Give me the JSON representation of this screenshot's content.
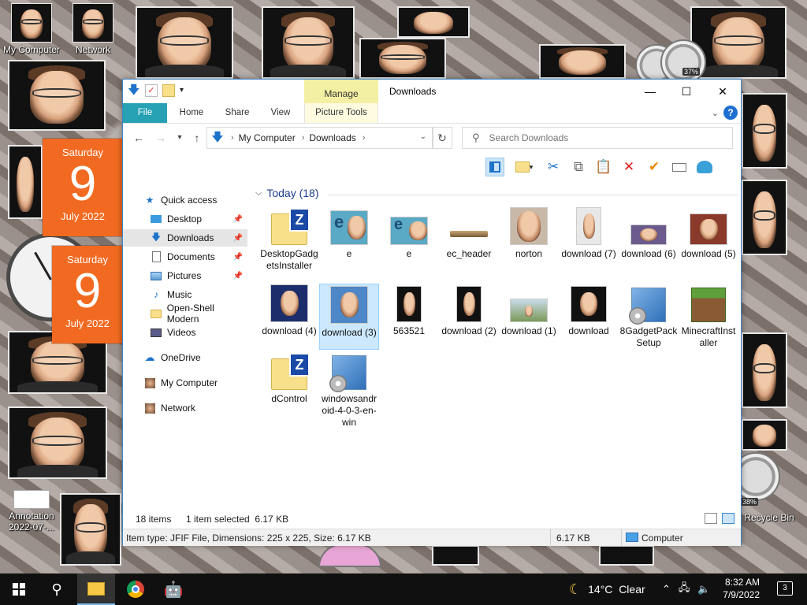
{
  "desktop": {
    "icons": [
      {
        "label": "My Computer"
      },
      {
        "label": "Network"
      },
      {
        "label": "Annotation 2022-07-..."
      },
      {
        "label": "Recycle Bin"
      }
    ],
    "calendars": [
      {
        "weekday": "Saturday",
        "day": "9",
        "month_year": "July 2022"
      },
      {
        "weekday": "Saturday",
        "day": "9",
        "month_year": "July 2022"
      }
    ],
    "gauges": [
      {
        "label": "37%"
      },
      {
        "label": "38%"
      }
    ]
  },
  "window": {
    "title": "Downloads",
    "contextual_tab_group": "Manage",
    "tabs": [
      "File",
      "Home",
      "Share",
      "View",
      "Picture Tools"
    ],
    "controls": {
      "minimize": "—",
      "maximize": "☐",
      "close": "✕"
    },
    "help": "?"
  },
  "address": {
    "breadcrumb": [
      "My Computer",
      "Downloads"
    ],
    "search_placeholder": "Search Downloads"
  },
  "nav_pane": {
    "items": [
      {
        "label": "Quick access",
        "icon": "star-icon"
      },
      {
        "label": "Desktop",
        "icon": "desktop-icon",
        "pinned": true
      },
      {
        "label": "Downloads",
        "icon": "download-icon",
        "pinned": true,
        "selected": true
      },
      {
        "label": "Documents",
        "icon": "documents-icon",
        "pinned": true
      },
      {
        "label": "Pictures",
        "icon": "pictures-icon",
        "pinned": true
      },
      {
        "label": "Music",
        "icon": "music-icon"
      },
      {
        "label": "Open-Shell Modern",
        "icon": "folder-icon"
      },
      {
        "label": "Videos",
        "icon": "videos-icon"
      },
      {
        "label": "OneDrive",
        "icon": "cloud-icon"
      },
      {
        "label": "My Computer",
        "icon": "computer-icon"
      },
      {
        "label": "Network",
        "icon": "network-icon"
      }
    ]
  },
  "files": {
    "group_title": "Today (18)",
    "items": [
      {
        "label": "DesktopGadgetsInstaller",
        "kind": "zip-folder"
      },
      {
        "label": "e",
        "kind": "picture"
      },
      {
        "label": "e",
        "kind": "picture"
      },
      {
        "label": "ec_header",
        "kind": "header"
      },
      {
        "label": "norton",
        "kind": "picture"
      },
      {
        "label": "download (7)",
        "kind": "picture"
      },
      {
        "label": "download (6)",
        "kind": "picture"
      },
      {
        "label": "download (5)",
        "kind": "picture"
      },
      {
        "label": "download (4)",
        "kind": "picture"
      },
      {
        "label": "download (3)",
        "kind": "picture",
        "selected": true
      },
      {
        "label": "563521",
        "kind": "picture"
      },
      {
        "label": "download (2)",
        "kind": "picture"
      },
      {
        "label": "download (1)",
        "kind": "picture"
      },
      {
        "label": "download",
        "kind": "picture"
      },
      {
        "label": "8GadgetPackSetup",
        "kind": "installer"
      },
      {
        "label": "MinecraftInstaller",
        "kind": "grass-block"
      },
      {
        "label": "dControl",
        "kind": "zip-folder"
      },
      {
        "label": "windowsandroid-4-0-3-en-win",
        "kind": "installer"
      }
    ]
  },
  "status": {
    "item_count": "18 items",
    "selection": "1 item selected  6.17 KB"
  },
  "details": {
    "info": "Item type: JFIF File, Dimensions: 225 x 225, Size: 6.17 KB",
    "size": "6.17 KB",
    "location": "Computer"
  },
  "taskbar": {
    "weather": "14°C  Clear",
    "time": "8:32 AM",
    "date": "7/9/2022",
    "notification_count": "3"
  }
}
